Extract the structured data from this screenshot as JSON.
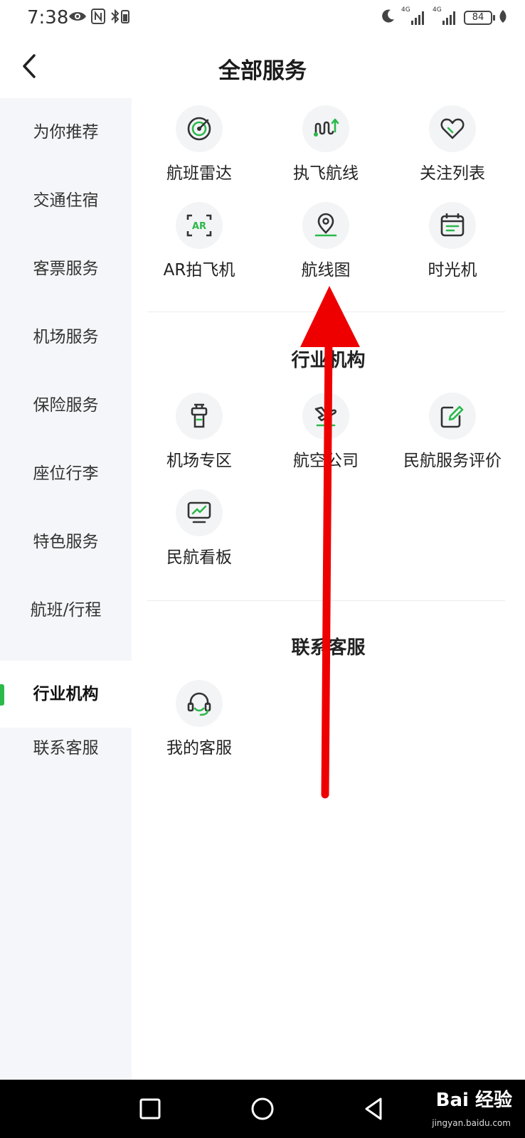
{
  "status_bar": {
    "time": "7:38",
    "signal1_label": "4G",
    "signal2_label": "4G",
    "battery": "84"
  },
  "header": {
    "title": "全部服务"
  },
  "sidebar": {
    "items": [
      {
        "label": "为你推荐"
      },
      {
        "label": "交通住宿"
      },
      {
        "label": "客票服务"
      },
      {
        "label": "机场服务"
      },
      {
        "label": "保险服务"
      },
      {
        "label": "座位行李"
      },
      {
        "label": "特色服务"
      },
      {
        "label": "航班/行程"
      },
      {
        "label": "行业机构",
        "active": true
      },
      {
        "label": "联系客服"
      }
    ],
    "accent_color": "#2bb94a"
  },
  "sections": [
    {
      "title": "",
      "items": [
        {
          "label": "航班雷达",
          "icon": "radar-icon"
        },
        {
          "label": "执飞航线",
          "icon": "route-icon"
        },
        {
          "label": "关注列表",
          "icon": "heart-icon"
        },
        {
          "label": "AR拍飞机",
          "icon": "ar-icon"
        },
        {
          "label": "航线图",
          "icon": "location-pin-icon"
        },
        {
          "label": "时光机",
          "icon": "calendar-icon"
        }
      ]
    },
    {
      "title": "行业机构",
      "items": [
        {
          "label": "机场专区",
          "icon": "control-tower-icon"
        },
        {
          "label": "航空公司",
          "icon": "airplane-icon"
        },
        {
          "label": "民航服务评价",
          "icon": "edit-icon"
        },
        {
          "label": "民航看板",
          "icon": "dashboard-icon"
        }
      ]
    },
    {
      "title": "联系客服",
      "items": [
        {
          "label": "我的客服",
          "icon": "headset-icon"
        }
      ]
    }
  ],
  "watermark": {
    "brand": "Bai 经验",
    "url": "jingyan.baidu.com"
  },
  "annotation": {
    "color": "#ee0000"
  }
}
